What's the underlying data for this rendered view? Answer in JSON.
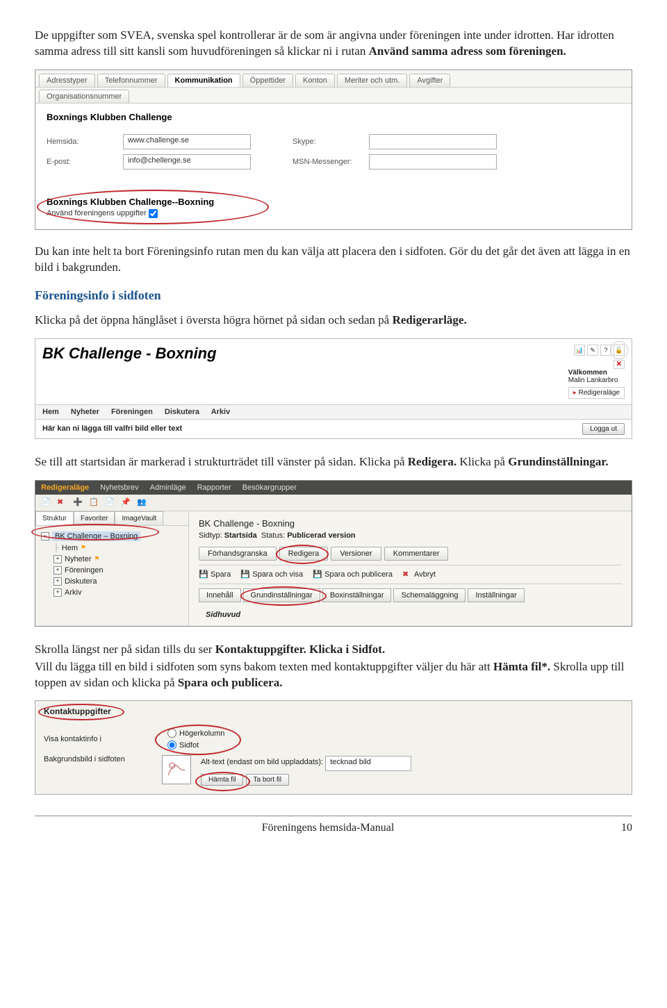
{
  "intro": {
    "p1a": "De uppgifter som SVEA, svenska spel kontrollerar är de som är angivna under föreningen inte under idrotten. Har idrotten samma adress till sitt kansli som huvudföreningen så klickar ni i rutan ",
    "p1b": "Använd samma adress som föreningen."
  },
  "ss1": {
    "tabs": [
      "Adresstyper",
      "Telefonnummer",
      "Kommunikation",
      "Öppettider",
      "Konton",
      "Meriter och utm.",
      "Avgifter"
    ],
    "subtab": "Organisationsnummer",
    "club": "Boxnings Klubben Challenge",
    "hemsida_lbl": "Hemsida:",
    "hemsida_val": "www.challenge.se",
    "skype_lbl": "Skype:",
    "epost_lbl": "E-post:",
    "epost_val": "info@chellenge.se",
    "msn_lbl": "MSN-Messenger:",
    "club2": "Boxnings Klubben Challenge--Boxning",
    "use_assoc": "Använd föreningens uppgifter"
  },
  "para2": "Du kan inte helt ta bort Föreningsinfo rutan men du kan välja att placera den i sidfoten. Gör du det går det även att lägga in en bild i bakgrunden.",
  "heading1": "Föreningsinfo i sidfoten",
  "para3a": "Klicka på det öppna hänglåset i översta högra hörnet på sidan och sedan på ",
  "para3b": "Redigerarläge.",
  "ss2": {
    "title": "BK Challenge - Boxning",
    "welcome": "Välkommen",
    "user": "Malin Lankarbro",
    "editmode": "Redigeraläge",
    "nav": [
      "Hem",
      "Nyheter",
      "Föreningen",
      "Diskutera",
      "Arkiv"
    ],
    "subtitle": "Här kan ni lägga till valfri bild eller text",
    "logout": "Logga ut"
  },
  "para4a": "Se till att startsidan är markerad i strukturträdet till vänster på sidan. Klicka på ",
  "para4b": "Redigera.",
  "para4c": " Klicka på ",
  "para4d": "Grundinställningar.",
  "ss3": {
    "menu": [
      "Redigeraläge",
      "Nyhetsbrev",
      "Adminläge",
      "Rapporter",
      "Besökargrupper"
    ],
    "lefttabs": [
      "Struktur",
      "Favoriter",
      "ImageVault"
    ],
    "tree_root": "BK Challenge – Boxning",
    "tree": [
      "Hem",
      "Nyheter",
      "Föreningen",
      "Diskutera",
      "Arkiv"
    ],
    "pg_title": "BK Challenge - Boxning",
    "sidtyp_lbl": "Sidtyp:",
    "sidtyp": "Startsida",
    "status_lbl": "Status:",
    "status": "Publicerad version",
    "rtabs": [
      "Förhandsgranska",
      "Redigera",
      "Versioner",
      "Kommentarer"
    ],
    "actions": [
      "Spara",
      "Spara och visa",
      "Spara och publicera",
      "Avbryt"
    ],
    "rtabs2": [
      "Innehåll",
      "Grundinställningar",
      "Boxinställningar",
      "Schemaläggning",
      "Inställningar"
    ],
    "sidhuvud": "Sidhuvud"
  },
  "para5a": "Skrolla längst ner på sidan tills du ser ",
  "para5b": "Kontaktuppgifter.",
  "para5c": " ",
  "para5d": "Klicka i Sidfot.",
  "para6a": "Vill du lägga till en bild i sidfoten som syns bakom texten med kontaktuppgifter väljer du här att ",
  "para6b": "Hämta fil*.",
  "para6c": " Skrolla upp till toppen av sidan och klicka på ",
  "para6d": "Spara och publicera.",
  "ss4": {
    "title": "Kontaktuppgifter",
    "visa": "Visa kontaktinfo i",
    "r1": "Högerkolumn",
    "r2": "Sidfot",
    "bglbl": "Bakgrundsbild i sidfoten",
    "alt_lbl": "Alt-text (endast om bild uppladdats):",
    "alt_val": "tecknad bild",
    "b1": "Hämta fil",
    "b2": "Ta bort fil"
  },
  "footer": {
    "title": "Föreningens hemsida-Manual",
    "page": "10"
  }
}
